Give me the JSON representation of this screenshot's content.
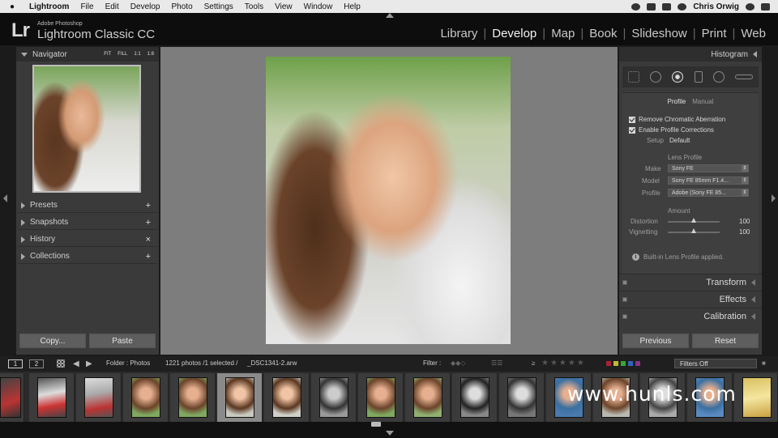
{
  "menubar": {
    "app": "Lightroom",
    "menus": [
      "File",
      "Edit",
      "Develop",
      "Photo",
      "Settings",
      "Tools",
      "View",
      "Window",
      "Help"
    ],
    "user": "Chris Orwig"
  },
  "identity": {
    "logo": "Lr",
    "brand_top": "Adobe Photoshop",
    "brand": "Lightroom Classic CC"
  },
  "modules": [
    "Library",
    "Develop",
    "Map",
    "Book",
    "Slideshow",
    "Print",
    "Web"
  ],
  "active_module": "Develop",
  "left": {
    "navigator": {
      "title": "Navigator",
      "opts": [
        "FIT",
        "FILL",
        "1:1",
        "1:8"
      ]
    },
    "panels": [
      {
        "label": "Presets",
        "action": "+"
      },
      {
        "label": "Snapshots",
        "action": "+"
      },
      {
        "label": "History",
        "action": "×"
      },
      {
        "label": "Collections",
        "action": "+"
      }
    ],
    "copy_label": "Copy...",
    "paste_label": "Paste"
  },
  "right": {
    "histogram_title": "Histogram",
    "lens": {
      "tabs": [
        "Profile",
        "Manual"
      ],
      "remove_ca": "Remove Chromatic Aberration",
      "enable_profile": "Enable Profile Corrections",
      "setup_label": "Setup",
      "setup_value": "Default",
      "section": "Lens Profile",
      "make_label": "Make",
      "make_value": "Sony FE",
      "model_label": "Model",
      "model_value": "Sony FE 85mm F1.4...",
      "profile_label": "Profile",
      "profile_value": "Adobe (Sony FE 85...",
      "amount_label": "Amount",
      "distortion_label": "Distortion",
      "distortion_value": "100",
      "vignetting_label": "Vignetting",
      "vignetting_value": "100",
      "info": "Built-in Lens Profile applied."
    },
    "panels": [
      "Transform",
      "Effects",
      "Calibration"
    ],
    "previous_label": "Previous",
    "reset_label": "Reset"
  },
  "filmstrip_toolbar": {
    "page1": "1",
    "page2": "2",
    "source": "Folder : Photos",
    "count": "1221 photos /1 selected /",
    "filename": "_DSC1341-2.arw",
    "filter_label": "Filter :",
    "filters_value": "Filters Off"
  },
  "watermark": "www.hunls.com"
}
